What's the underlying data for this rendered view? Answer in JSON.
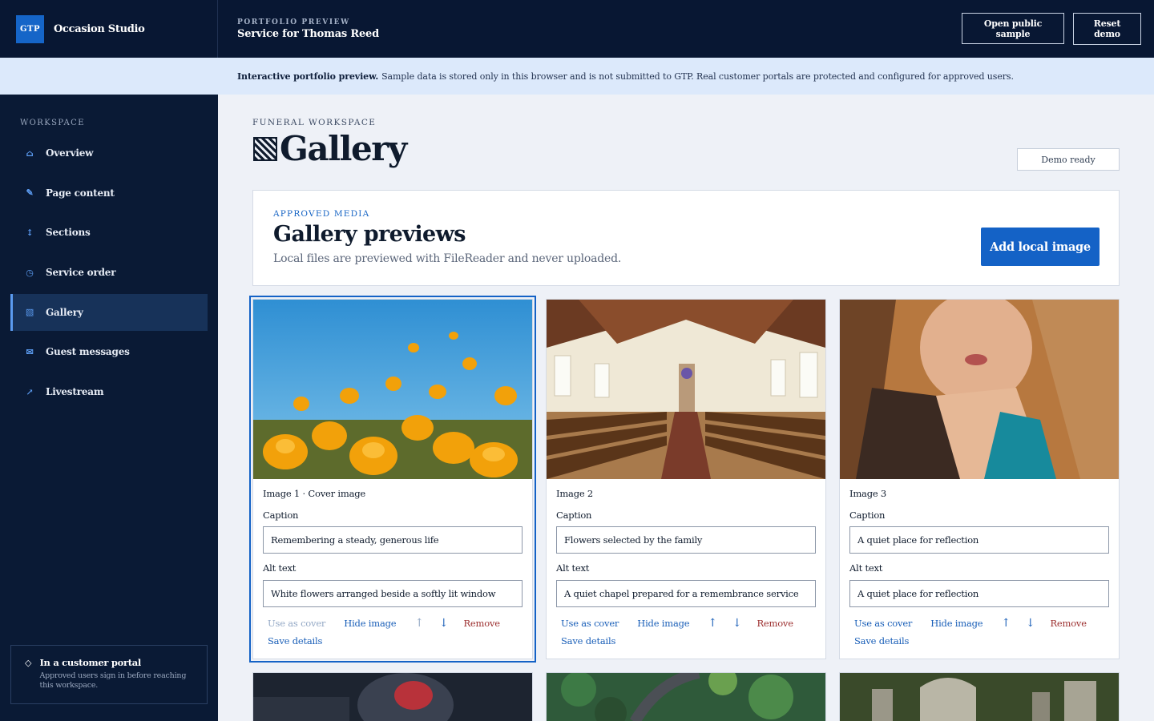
{
  "brand": {
    "badge": "GTP",
    "name": "Occasion Studio"
  },
  "crumb": {
    "kicker": "PORTFOLIO PREVIEW",
    "title": "Service for Thomas Reed"
  },
  "top_actions": {
    "open_public": "Open public sample",
    "reset": "Reset demo"
  },
  "notice": {
    "strong": "Interactive portfolio preview.",
    "text": "Sample data is stored only in this browser and is not submitted to GTP. Real customer portals are protected and configured for approved users."
  },
  "sidebar": {
    "heading": "WORKSPACE",
    "items": [
      {
        "label": "Overview",
        "icon": "home-icon",
        "glyph": "⌂"
      },
      {
        "label": "Page content",
        "icon": "pen-icon",
        "glyph": "✎"
      },
      {
        "label": "Sections",
        "icon": "reorder-icon",
        "glyph": "↕"
      },
      {
        "label": "Service order",
        "icon": "clock-icon",
        "glyph": "◷"
      },
      {
        "label": "Gallery",
        "icon": "gallery-icon",
        "glyph": "▧"
      },
      {
        "label": "Guest messages",
        "icon": "mail-icon",
        "glyph": "✉"
      },
      {
        "label": "Livestream",
        "icon": "arrow-up-right-icon",
        "glyph": "↗"
      }
    ],
    "active": "Gallery",
    "footer": {
      "glyph": "◇",
      "title": "In a customer portal",
      "text": "Approved users sign in before reaching this workspace."
    }
  },
  "main": {
    "kicker": "FUNERAL WORKSPACE",
    "title": "Gallery",
    "status": "Demo ready"
  },
  "panel": {
    "kicker": "APPROVED MEDIA",
    "title": "Gallery previews",
    "subtitle": "Local files are previewed with FileReader and never uploaded.",
    "add_button": "Add local image"
  },
  "labels": {
    "caption": "Caption",
    "alt_text": "Alt text",
    "use_as_cover": "Use as cover",
    "hide_image": "Hide image",
    "move_up": "↑",
    "move_down": "↓",
    "remove": "Remove",
    "save_details": "Save details"
  },
  "cards": [
    {
      "title": "Image 1 · Cover image",
      "caption": "Remembering a steady, generous life",
      "alt": "White flowers arranged beside a softly lit window",
      "is_cover": true,
      "photo": "orange poppies against blue sky"
    },
    {
      "title": "Image 2",
      "caption": "Flowers selected by the family",
      "alt": "A quiet chapel prepared for a remembrance service",
      "is_cover": false,
      "photo": "chapel interior with wooden pews"
    },
    {
      "title": "Image 3",
      "caption": "A quiet place for reflection",
      "alt": "A quiet place for reflection",
      "is_cover": false,
      "photo": "portrait of a woman"
    }
  ],
  "colors": {
    "accent": "#1462c6",
    "topbar": "#081733",
    "sidebar": "#0a1a35",
    "notice": "#dce9fb",
    "remove": "#9c2f2f"
  }
}
